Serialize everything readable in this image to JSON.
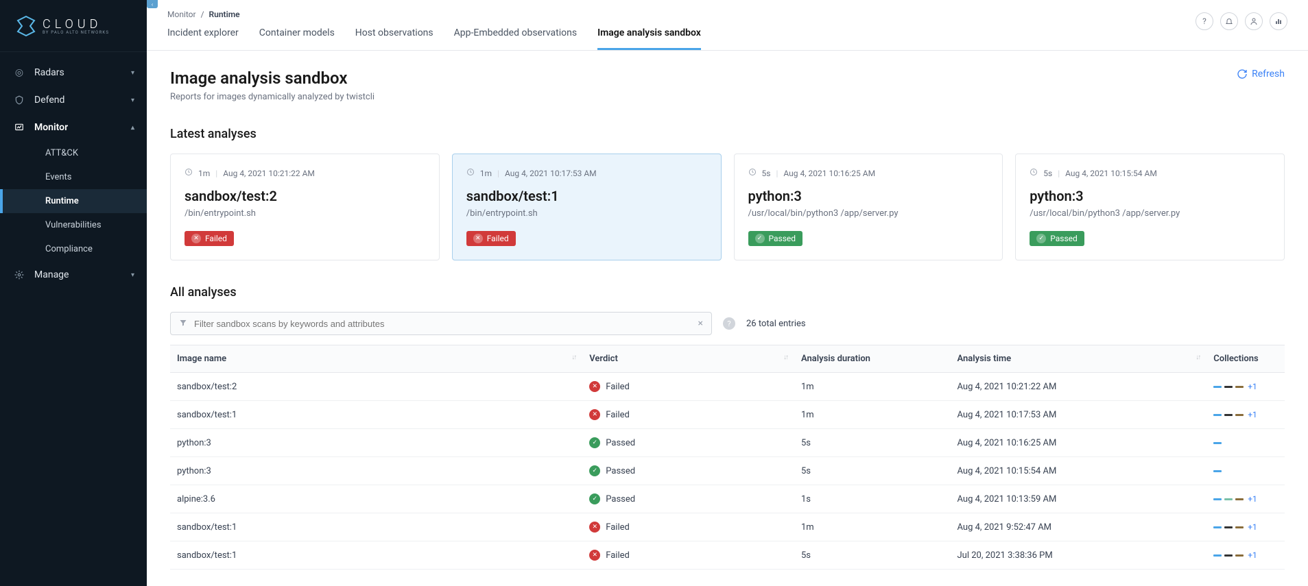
{
  "brand": {
    "name": "CLOUD",
    "sub": "BY PALO ALTO NETWORKS"
  },
  "sidebar": {
    "items": [
      {
        "label": "Radars",
        "icon": "radar",
        "expanded": false
      },
      {
        "label": "Defend",
        "icon": "shield",
        "expanded": false
      },
      {
        "label": "Monitor",
        "icon": "monitor",
        "expanded": true,
        "active": true,
        "children": [
          {
            "label": "ATT&CK"
          },
          {
            "label": "Events"
          },
          {
            "label": "Runtime",
            "active": true
          },
          {
            "label": "Vulnerabilities"
          },
          {
            "label": "Compliance"
          }
        ]
      },
      {
        "label": "Manage",
        "icon": "gear",
        "expanded": false
      }
    ]
  },
  "breadcrumb": {
    "root": "Monitor",
    "current": "Runtime"
  },
  "tabs": [
    {
      "label": "Incident explorer"
    },
    {
      "label": "Container models"
    },
    {
      "label": "Host observations"
    },
    {
      "label": "App-Embedded observations"
    },
    {
      "label": "Image analysis sandbox",
      "active": true
    }
  ],
  "page": {
    "title": "Image analysis sandbox",
    "description": "Reports for images dynamically analyzed by twistcli",
    "refresh_label": "Refresh"
  },
  "sections": {
    "latest": "Latest analyses",
    "all": "All analyses"
  },
  "cards": [
    {
      "duration": "1m",
      "time": "Aug 4, 2021 10:21:22 AM",
      "title": "sandbox/test:2",
      "cmd": "/bin/entrypoint.sh",
      "status": "Failed",
      "status_class": "failed"
    },
    {
      "duration": "1m",
      "time": "Aug 4, 2021 10:17:53 AM",
      "title": "sandbox/test:1",
      "cmd": "/bin/entrypoint.sh",
      "status": "Failed",
      "status_class": "failed",
      "selected": true
    },
    {
      "duration": "5s",
      "time": "Aug 4, 2021 10:16:25 AM",
      "title": "python:3",
      "cmd": "/usr/local/bin/python3 /app/server.py",
      "status": "Passed",
      "status_class": "passed"
    },
    {
      "duration": "5s",
      "time": "Aug 4, 2021 10:15:54 AM",
      "title": "python:3",
      "cmd": "/usr/local/bin/python3 /app/server.py",
      "status": "Passed",
      "status_class": "passed"
    }
  ],
  "filter": {
    "placeholder": "Filter sandbox scans by keywords and attributes",
    "total_entries": "26 total entries"
  },
  "table": {
    "columns": [
      "Image name",
      "Verdict",
      "Analysis duration",
      "Analysis time",
      "Collections"
    ],
    "rows": [
      {
        "name": "sandbox/test:2",
        "verdict": "Failed",
        "duration": "1m",
        "time": "Aug 4, 2021 10:21:22 AM",
        "collections": [
          "#4aa5e8",
          "#333",
          "#8a6d3b"
        ],
        "more": "+1"
      },
      {
        "name": "sandbox/test:1",
        "verdict": "Failed",
        "duration": "1m",
        "time": "Aug 4, 2021 10:17:53 AM",
        "collections": [
          "#4aa5e8",
          "#333",
          "#8a6d3b"
        ],
        "more": "+1"
      },
      {
        "name": "python:3",
        "verdict": "Passed",
        "duration": "5s",
        "time": "Aug 4, 2021 10:16:25 AM",
        "collections": [
          "#4aa5e8"
        ],
        "more": ""
      },
      {
        "name": "python:3",
        "verdict": "Passed",
        "duration": "5s",
        "time": "Aug 4, 2021 10:15:54 AM",
        "collections": [
          "#4aa5e8"
        ],
        "more": ""
      },
      {
        "name": "alpine:3.6",
        "verdict": "Passed",
        "duration": "1s",
        "time": "Aug 4, 2021 10:13:59 AM",
        "collections": [
          "#4aa5e8",
          "#7ac0a8",
          "#8a6d3b"
        ],
        "more": "+1"
      },
      {
        "name": "sandbox/test:1",
        "verdict": "Failed",
        "duration": "1m",
        "time": "Aug 4, 2021 9:52:47 AM",
        "collections": [
          "#4aa5e8",
          "#333",
          "#8a6d3b"
        ],
        "more": "+1"
      },
      {
        "name": "sandbox/test:1",
        "verdict": "Failed",
        "duration": "5s",
        "time": "Jul 20, 2021 3:38:36 PM",
        "collections": [
          "#4aa5e8",
          "#333",
          "#8a6d3b"
        ],
        "more": "+1"
      }
    ]
  }
}
